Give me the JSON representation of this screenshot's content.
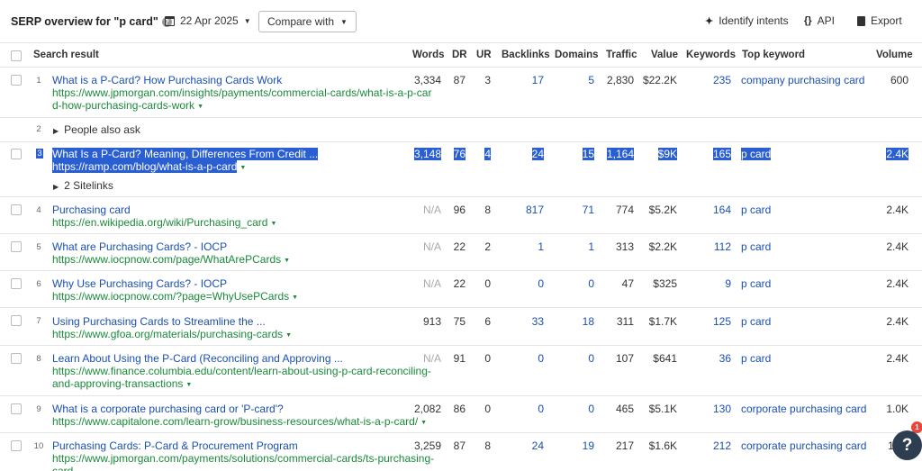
{
  "header": {
    "title": "SERP overview for \"p card\"",
    "help_glyph": "?",
    "date": "22 Apr 2025",
    "compare_label": "Compare with",
    "identify_label": "Identify intents",
    "api_label": "API",
    "export_label": "Export"
  },
  "columns": {
    "search_result": "Search result",
    "words": "Words",
    "dr": "DR",
    "ur": "UR",
    "backlinks": "Backlinks",
    "domains": "Domains",
    "traffic": "Traffic",
    "value": "Value",
    "keywords": "Keywords",
    "top_keyword": "Top keyword",
    "volume": "Volume"
  },
  "rows": [
    {
      "num": "1",
      "title": "What is a P-Card? How Purchasing Cards Work",
      "url_line1": "https://www.jpmorgan.com/insights/payments/commercial-cards/what-is-a-p-car",
      "url_line2": "d-how-purchasing-cards-work",
      "words": "3,334",
      "dr": "87",
      "ur": "3",
      "backlinks": "17",
      "domains": "5",
      "traffic": "2,830",
      "value": "$22.2K",
      "keywords": "235",
      "top_keyword": "company purchasing card",
      "volume": "600"
    },
    {
      "num": "3",
      "title": "What Is a P-Card? Meaning, Differences From Credit ...",
      "url_line1": "https://ramp.com/blog/what-is-a-p-card",
      "words": "3,148",
      "dr": "76",
      "ur": "4",
      "backlinks": "24",
      "domains": "15",
      "traffic": "1,164",
      "value": "$9K",
      "keywords": "165",
      "top_keyword": "p card",
      "volume": "2.4K",
      "sitelinks": "2 Sitelinks"
    },
    {
      "num": "4",
      "title": "Purchasing card",
      "url_line1": "https://en.wikipedia.org/wiki/Purchasing_card",
      "words": "N/A",
      "dr": "96",
      "ur": "8",
      "backlinks": "817",
      "domains": "71",
      "traffic": "774",
      "value": "$5.2K",
      "keywords": "164",
      "top_keyword": "p card",
      "volume": "2.4K"
    },
    {
      "num": "5",
      "title": "What are Purchasing Cards? - IOCP",
      "url_line1": "https://www.iocpnow.com/page/WhatArePCards",
      "words": "N/A",
      "dr": "22",
      "ur": "2",
      "backlinks": "1",
      "domains": "1",
      "traffic": "313",
      "value": "$2.2K",
      "keywords": "112",
      "top_keyword": "p card",
      "volume": "2.4K"
    },
    {
      "num": "6",
      "title": "Why Use Purchasing Cards? - IOCP",
      "url_line1": "https://www.iocpnow.com/?page=WhyUsePCards",
      "words": "N/A",
      "dr": "22",
      "ur": "0",
      "backlinks": "0",
      "domains": "0",
      "traffic": "47",
      "value": "$325",
      "keywords": "9",
      "top_keyword": "p card",
      "volume": "2.4K"
    },
    {
      "num": "7",
      "title": "Using Purchasing Cards to Streamline the ...",
      "url_line1": "https://www.gfoa.org/materials/purchasing-cards",
      "words": "913",
      "dr": "75",
      "ur": "6",
      "backlinks": "33",
      "domains": "18",
      "traffic": "311",
      "value": "$1.7K",
      "keywords": "125",
      "top_keyword": "p card",
      "volume": "2.4K"
    },
    {
      "num": "8",
      "title": "Learn About Using the P-Card (Reconciling and Approving ...",
      "url_line1": "https://www.finance.columbia.edu/content/learn-about-using-p-card-reconciling-",
      "url_line2": "and-approving-transactions",
      "words": "N/A",
      "dr": "91",
      "ur": "0",
      "backlinks": "0",
      "domains": "0",
      "traffic": "107",
      "value": "$641",
      "keywords": "36",
      "top_keyword": "p card",
      "volume": "2.4K"
    },
    {
      "num": "9",
      "title": "What is a corporate purchasing card or 'P-card'?",
      "url_line1": "https://www.capitalone.com/learn-grow/business-resources/what-is-a-p-card/",
      "words": "2,082",
      "dr": "86",
      "ur": "0",
      "backlinks": "0",
      "domains": "0",
      "traffic": "465",
      "value": "$5.1K",
      "keywords": "130",
      "top_keyword": "corporate purchasing card",
      "volume": "1.0K"
    },
    {
      "num": "10",
      "title": "Purchasing Cards: P-Card & Procurement Program",
      "url_line1": "https://www.jpmorgan.com/payments/solutions/commercial-cards/ts-purchasing-",
      "url_line2": "card",
      "words": "3,259",
      "dr": "87",
      "ur": "8",
      "backlinks": "24",
      "domains": "19",
      "traffic": "217",
      "value": "$1.6K",
      "keywords": "212",
      "top_keyword": "corporate purchasing card",
      "volume": "1"
    }
  ],
  "people_also_ask": {
    "num": "2",
    "label": "People also ask"
  },
  "help_fab": {
    "label": "?",
    "badge": "1"
  },
  "colors": {
    "link": "#1a4fb5",
    "url": "#1a8a3a",
    "highlight": "#2a5fd3"
  }
}
